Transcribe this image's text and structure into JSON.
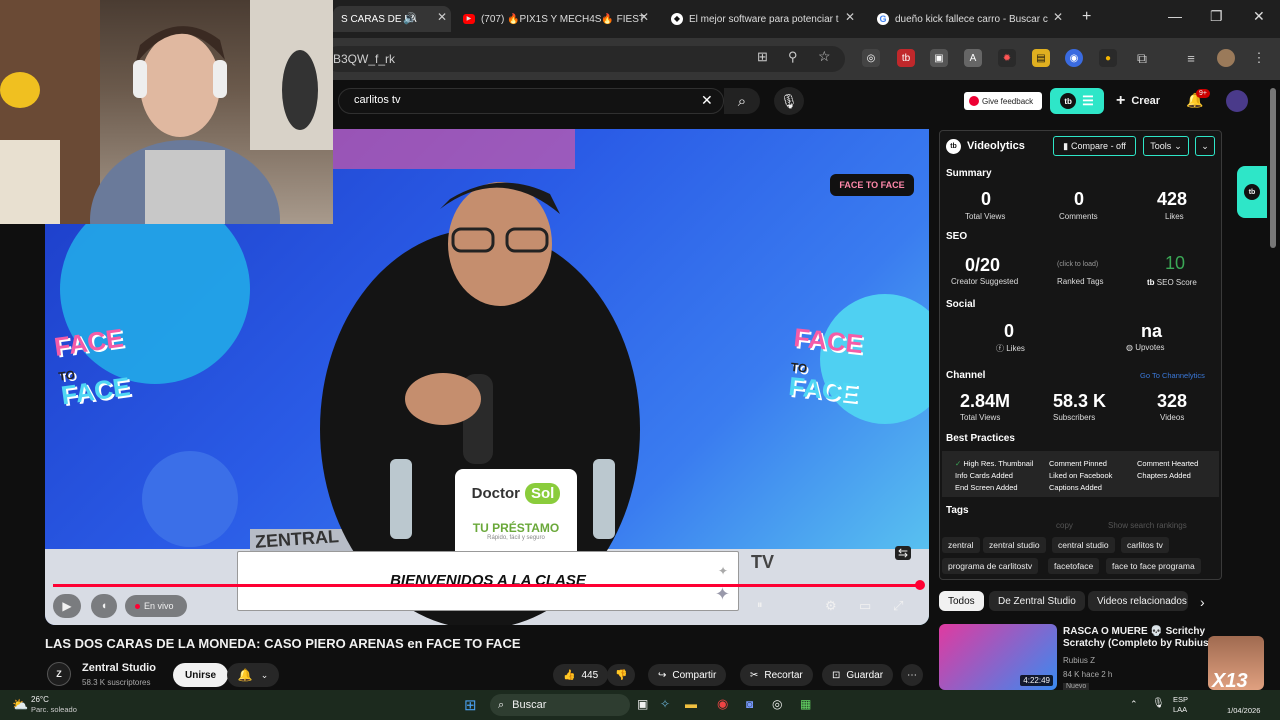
{
  "browser": {
    "tabs": [
      {
        "title": "S CARAS DE LA",
        "active": true
      },
      {
        "title": "(707) 🔥PIX1S Y MECH4S🔥 FIEST"
      },
      {
        "title": "El mejor software para potenciar t"
      },
      {
        "title": "dueño kick fallece carro - Buscar c"
      }
    ],
    "url": "B3QW_f_rk"
  },
  "youtube": {
    "search_query": "carlitos tv",
    "feedback_label": "Give feedback",
    "create_label": "Crear",
    "notif_badge": "9+"
  },
  "video": {
    "title": "LAS DOS CARAS DE LA MONEDA: CASO PIERO ARENAS en FACE TO FACE",
    "live_label": "En vivo",
    "banner_text": "BIENVENIDOS A LA CLASE",
    "sponsor_brand": "Doctor",
    "sponsor_brand2": "Sol",
    "sponsor_tagline": "TU PRÉSTAMO",
    "sponsor_sub": "Rápido, fácil y seguro",
    "face_logo_top": "FACE",
    "face_logo_to": "TO",
    "face_logo_bottom": "FACE",
    "corner_logo": "FACE TO FACE",
    "studio_text": "ZENTRAL",
    "tv_text": "TV"
  },
  "channel": {
    "name": "Zentral Studio",
    "subs": "58.3 K suscriptores",
    "join_label": "Unirse"
  },
  "actions": {
    "likes": "445",
    "share": "Compartir",
    "clip": "Recortar",
    "save": "Guardar"
  },
  "videolytics": {
    "brand": "Videolytics",
    "compare": "Compare - off",
    "tools": "Tools",
    "summary_label": "Summary",
    "total_views": "0",
    "total_views_label": "Total Views",
    "comments": "0",
    "comments_label": "Comments",
    "likes": "428",
    "likes_label": "Likes",
    "seo_label": "SEO",
    "creator_suggested": "0/20",
    "creator_suggested_label": "Creator Suggested",
    "ranked_tags_hint": "(click to load)",
    "ranked_tags_label": "Ranked Tags",
    "seo_score": "10",
    "seo_score_label": "SEO Score",
    "social_label": "Social",
    "fb_likes": "0",
    "fb_likes_label": "Likes",
    "upvotes": "na",
    "upvotes_label": "Upvotes",
    "channel_label": "Channel",
    "channelytics_link": "Go To Channelytics",
    "ch_views": "2.84M",
    "ch_views_label": "Total Views",
    "ch_subs": "58.3 K",
    "ch_subs_label": "Subscribers",
    "ch_videos": "328",
    "ch_videos_label": "Videos",
    "bp_label": "Best Practices",
    "best_practices": [
      "High Res. Thumbnail",
      "Comment Pinned",
      "Comment Hearted",
      "Info Cards Added",
      "Liked on Facebook",
      "Chapters Added",
      "End Screen Added",
      "Captions Added"
    ],
    "tags_label": "Tags",
    "copy_label": "copy",
    "show_rankings": "Show search rankings",
    "tags": [
      "zentral",
      "zentral studio",
      "central studio",
      "carlitos tv",
      "programa de carlitostv",
      "facetoface",
      "face to face programa"
    ]
  },
  "chips": [
    "Todos",
    "De Zentral Studio",
    "Videos relacionados"
  ],
  "related": {
    "title": "RASCA O MUERE 💀 Scritchy Scratchy (Completo by Rubius)",
    "channel": "Rubius Z",
    "meta": "84 K hace 2 h",
    "badge": "Nuevo",
    "duration": "4:22:49",
    "overlay": "X13"
  },
  "taskbar": {
    "weather_temp": "26°C",
    "weather_desc": "Parc. soleado",
    "search": "Buscar",
    "lang": "ESP",
    "lang2": "LAA",
    "date": "1/04/2026"
  },
  "colors": {
    "accent": "#ff0033",
    "vl_teal": "#2ee6c8",
    "seo_green": "#3aa755"
  }
}
